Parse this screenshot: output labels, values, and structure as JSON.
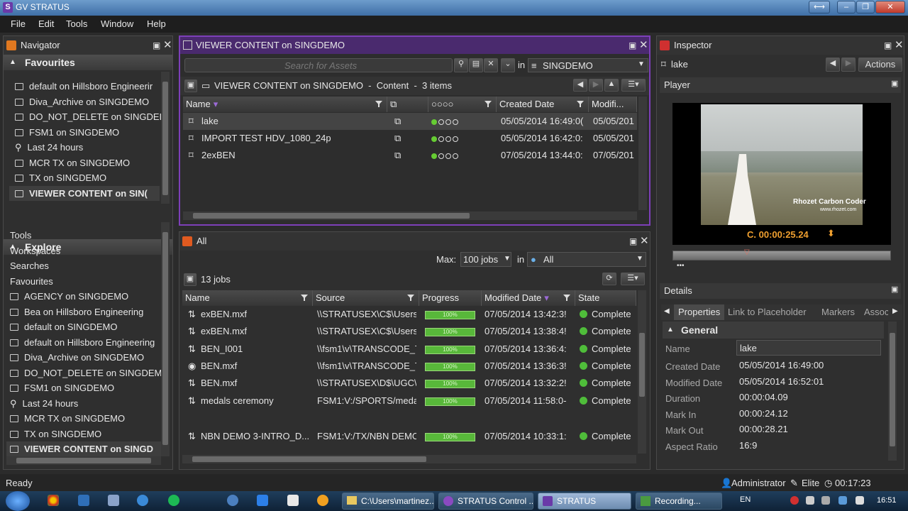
{
  "app": {
    "title": "GV STRATUS",
    "logo": "S"
  },
  "menu": [
    "File",
    "Edit",
    "Tools",
    "Window",
    "Help"
  ],
  "navigator": {
    "title": "Navigator",
    "favourites_label": "Favourites",
    "favourites": [
      "default on Hillsboro Engineerir",
      "Diva_Archive on SINGDEMO",
      "DO_NOT_DELETE on SINGDEI",
      "FSM1 on SINGDEMO",
      "Last 24 hours",
      "MCR TX on SINGDEMO",
      "TX on SINGDEMO",
      "VIEWER CONTENT on SIN("
    ],
    "explore_label": "Explore",
    "explore": [
      "Tools",
      "Workspaces",
      "Searches",
      "Favourites",
      "AGENCY on SINGDEMO",
      "Bea on Hillsboro Engineering",
      "default on SINGDEMO",
      "default on Hillsboro Engineering",
      "Diva_Archive on SINGDEMO",
      "DO_NOT_DELETE on SINGDEMO",
      "FSM1 on SINGDEMO",
      "Last 24 hours",
      "MCR TX on SINGDEMO",
      "TX on SINGDEMO",
      "VIEWER CONTENT on SINGD"
    ]
  },
  "viewer": {
    "title": "VIEWER CONTENT on SINGDEMO",
    "search_placeholder": "Search for Assets",
    "in_label": "in",
    "scope": "SINGDEMO",
    "breadcrumb": "VIEWER CONTENT on SINGDEMO  -  Content  -  3 items",
    "columns": [
      "Name",
      "",
      "○○○○",
      "Created Date",
      "Modifi..."
    ],
    "rows": [
      {
        "name": "lake",
        "created": "05/05/2014 16:49:0(",
        "modified": "05/05/201"
      },
      {
        "name": "IMPORT TEST HDV_1080_24p",
        "created": "05/05/2014 16:42:0:",
        "modified": "05/05/201"
      },
      {
        "name": "2exBEN",
        "created": "07/05/2014 13:44:0:",
        "modified": "07/05/201"
      }
    ]
  },
  "jobs": {
    "title": "All",
    "max_label": "Max:",
    "max_value": "100 jobs",
    "in_label": "in",
    "scope": "All",
    "count": "13 jobs",
    "columns": [
      "Name",
      "Source",
      "Progress",
      "Modified Date",
      "State"
    ],
    "progress_text": "100%",
    "progress_value": 1.0,
    "rows": [
      {
        "icon": "transfer-icon",
        "name": "exBEN.mxf",
        "source": "\\\\STRATUSEX\\C$\\Users\\",
        "modified": "07/05/2014 13:42:3!",
        "state": "Complete"
      },
      {
        "icon": "transfer-icon",
        "name": "exBEN.mxf",
        "source": "\\\\STRATUSEX\\C$\\Users\\",
        "modified": "07/05/2014 13:38:4!",
        "state": "Complete"
      },
      {
        "icon": "transfer-icon",
        "name": "BEN_I001",
        "source": "\\\\fsm1\\v\\TRANSCODE_T",
        "modified": "07/05/2014 13:36:4:",
        "state": "Complete"
      },
      {
        "icon": "eye-icon",
        "name": "BEN.mxf",
        "source": "\\\\fsm1\\v\\TRANSCODE_T",
        "modified": "07/05/2014 13:36:3!",
        "state": "Complete"
      },
      {
        "icon": "transfer-icon",
        "name": "BEN.mxf",
        "source": "\\\\STRATUSEX\\D$\\UGC\\I",
        "modified": "07/05/2014 13:32:2!",
        "state": "Complete"
      },
      {
        "icon": "transfer-icon",
        "name": "medals ceremony",
        "source": "FSM1:V:/SPORTS/meda",
        "modified": "07/05/2014 11:58:0-",
        "state": "Complete"
      },
      {
        "icon": "transfer-icon",
        "name": "NBN DEMO 3-INTRO_D...",
        "source": "FSM1:V:/TX/NBN DEMO",
        "modified": "07/05/2014 10:33:1:",
        "state": "Complete"
      }
    ]
  },
  "inspector": {
    "title": "Inspector",
    "asset": "lake",
    "actions": "Actions",
    "player_label": "Player",
    "watermark": "Rhozet Carbon Coder",
    "watermark_sub": "www.rhozet.com",
    "timecode": "C. 00:00:25.24",
    "details_label": "Details",
    "tabs": [
      "Properties",
      "Link to Placeholder",
      "Markers",
      "Associat"
    ],
    "group": "General",
    "fields": [
      {
        "label": "Name",
        "value": "lake"
      },
      {
        "label": "Created Date",
        "value": "05/05/2014 16:49:00"
      },
      {
        "label": "Modified Date",
        "value": "05/05/2014 16:52:01"
      },
      {
        "label": "Duration",
        "value": "00:00:04.09"
      },
      {
        "label": "Mark In",
        "value": "00:00:24.12"
      },
      {
        "label": "Mark Out",
        "value": "00:00:28.21"
      },
      {
        "label": "Aspect Ratio",
        "value": "16:9"
      }
    ]
  },
  "status": {
    "left": "Ready",
    "user": "Administrator",
    "tier": "Elite",
    "clock": "00:17:23"
  },
  "taskbar": {
    "tasks": [
      "C:\\Users\\martinez...",
      "STRATUS Control ...",
      "STRATUS",
      "Recording..."
    ],
    "lang": "EN",
    "time": "16:51"
  }
}
